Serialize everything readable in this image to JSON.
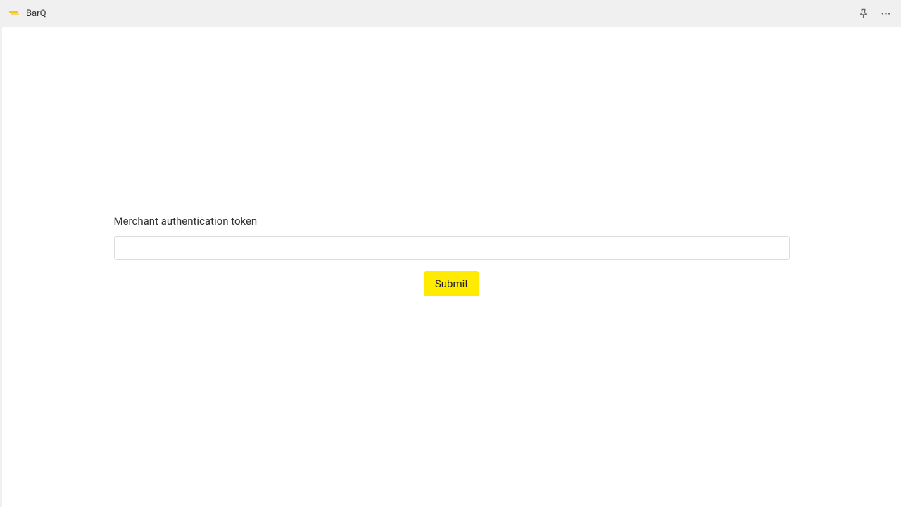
{
  "header": {
    "app_title": "BarQ"
  },
  "form": {
    "label": "Merchant authentication token",
    "input_value": "",
    "submit_label": "Submit"
  }
}
